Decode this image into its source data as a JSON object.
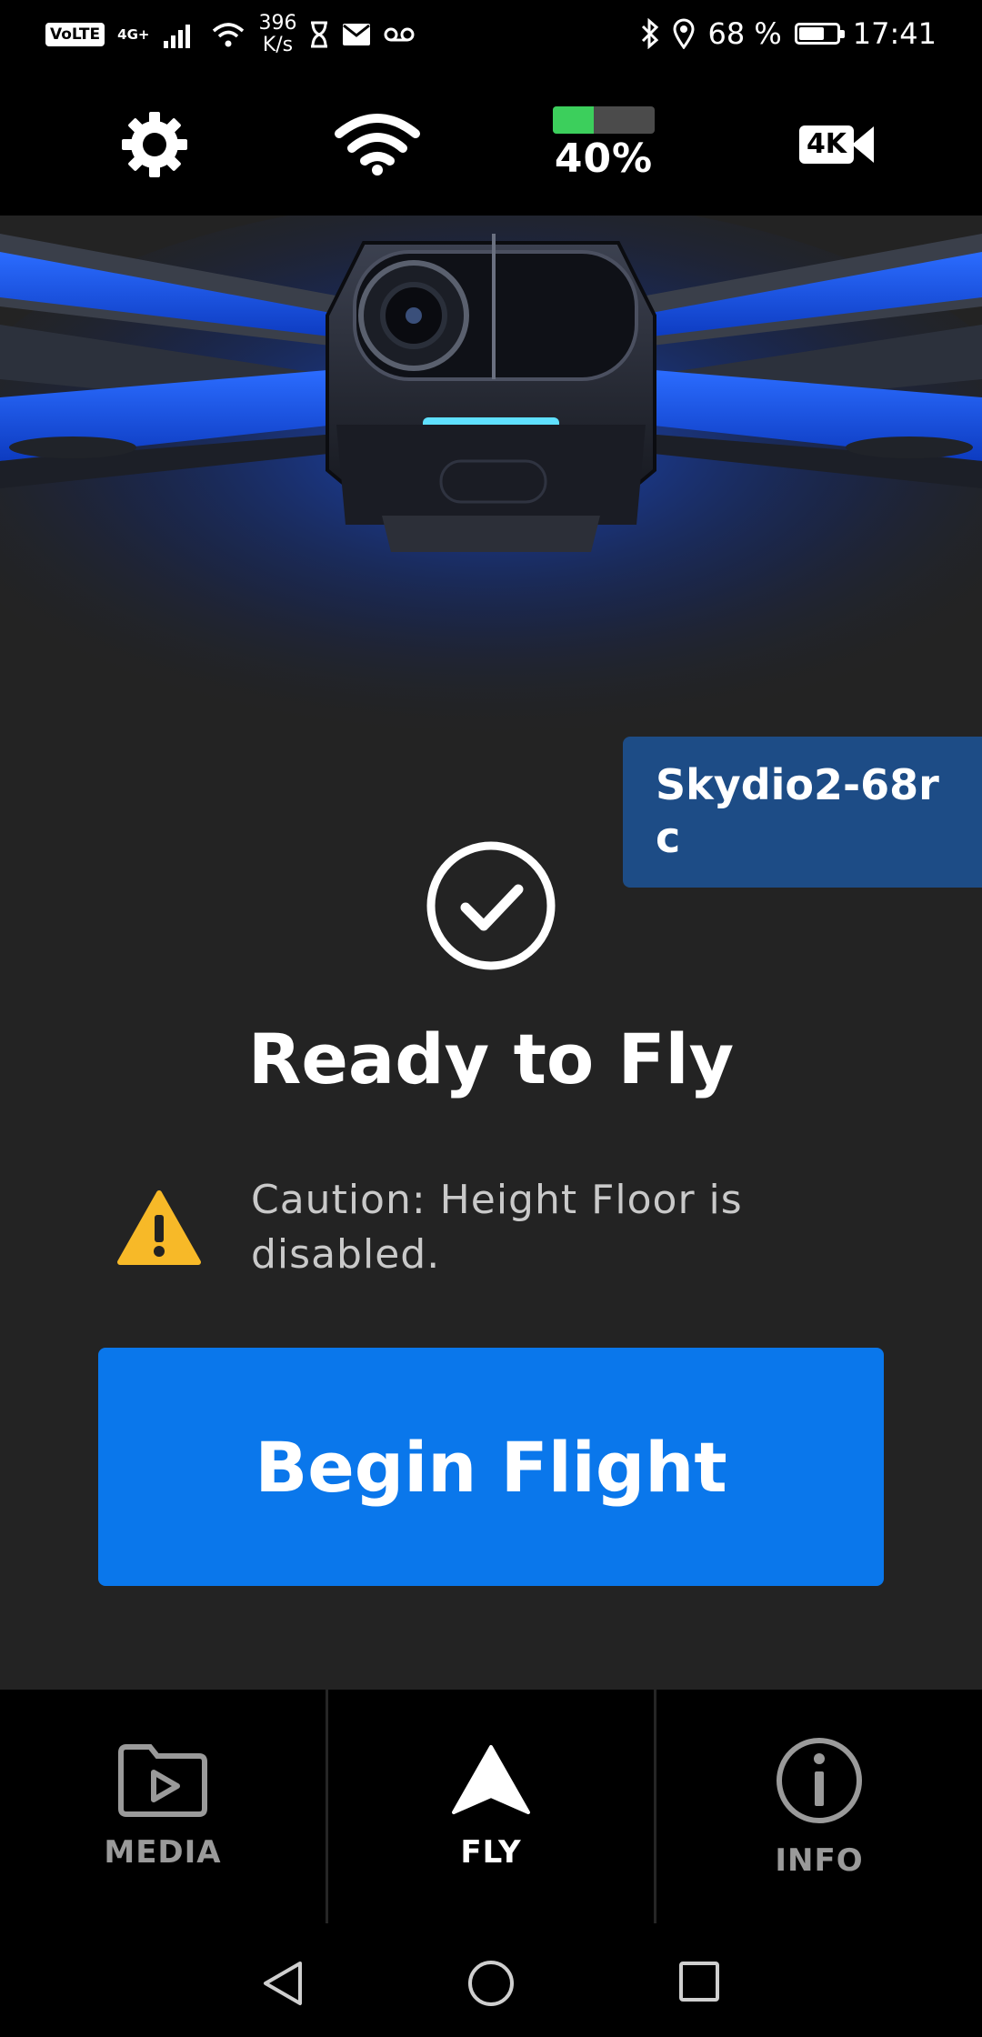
{
  "status_bar": {
    "volte": "VoLTE",
    "network": "4G+",
    "speed_value": "396",
    "speed_unit": "K/s",
    "battery_percent": "68 %",
    "battery_level": 0.68,
    "time": "17:41",
    "icons": [
      "signal-icon",
      "wifi-icon",
      "hourglass-icon",
      "mail-icon",
      "voicemail-icon",
      "bluetooth-icon",
      "location-icon",
      "battery-icon"
    ]
  },
  "top_bar": {
    "drone_battery_label": "40%",
    "drone_battery_level": 0.4,
    "resolution_label": "4K",
    "icons": [
      "settings-icon",
      "wifi-icon",
      "battery-icon",
      "camera-icon"
    ]
  },
  "device": {
    "name": "Skydio2-68rc"
  },
  "status": {
    "title": "Ready to Fly",
    "caution": "Caution: Height Floor is disabled."
  },
  "actions": {
    "begin_flight": "Begin Flight"
  },
  "tabs": [
    {
      "label": "MEDIA",
      "icon": "media-folder-icon",
      "active": false
    },
    {
      "label": "FLY",
      "icon": "fly-arrow-icon",
      "active": true
    },
    {
      "label": "INFO",
      "icon": "info-icon",
      "active": false
    }
  ],
  "colors": {
    "accent": "#0a77eb",
    "battery_green": "#3ccf5c",
    "warning": "#f7b928",
    "name_tag": "#1d4c86"
  }
}
